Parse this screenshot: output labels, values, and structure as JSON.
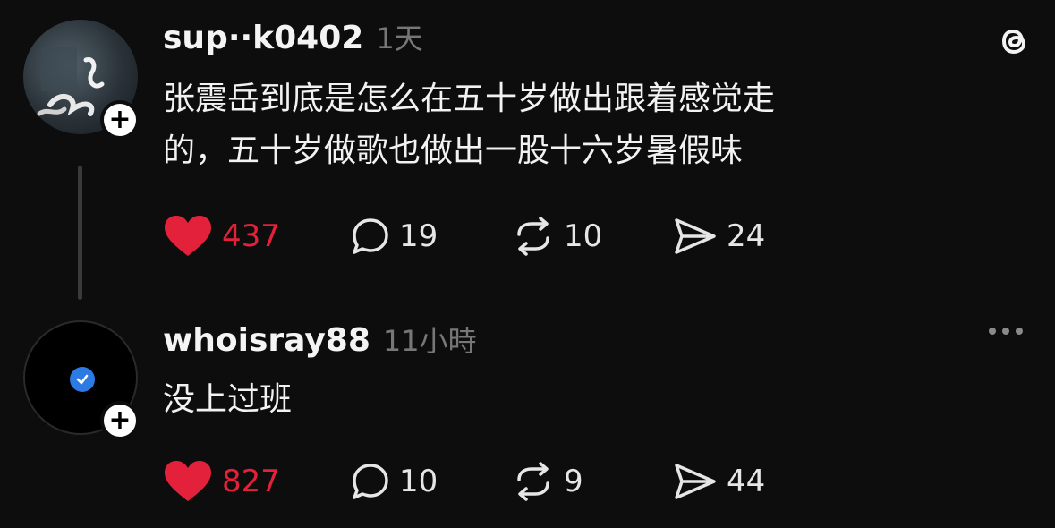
{
  "app": {
    "name": "Threads",
    "logo_icon": "threads-logo-icon",
    "accent_like": "#e3213a"
  },
  "posts": [
    {
      "username": "sup··k0402",
      "time": "1天",
      "text": "张震岳到底是怎么在五十岁做出跟着感觉走\n的，五十岁做歌也做出一股十六岁暑假味",
      "liked": true,
      "likes": "437",
      "replies": "19",
      "reposts": "10",
      "shares": "24"
    },
    {
      "username": "whoisray88",
      "time": "11小時",
      "text": "没上过班",
      "liked": true,
      "likes": "827",
      "replies": "10",
      "reposts": "9",
      "shares": "44"
    }
  ]
}
